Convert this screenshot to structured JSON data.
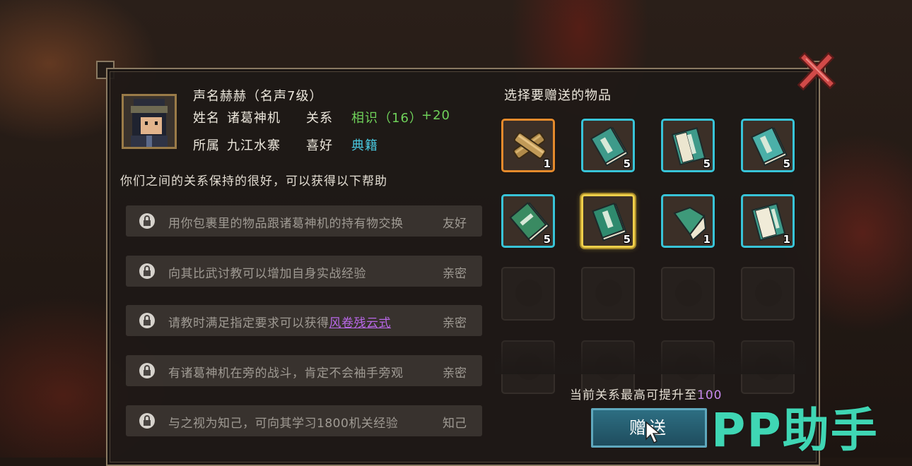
{
  "character": {
    "reputation": "声名赫赫（名声7级）",
    "name_label": "姓名",
    "name": "诸葛神机",
    "relation_label": "关系",
    "relation": "相识（16）",
    "relation_bonus": "+20",
    "faction_label": "所属",
    "faction": "九江水寨",
    "hobby_label": "喜好",
    "hobby": "典籍"
  },
  "help_intro": "你们之间的关系保持的很好，可以获得以下帮助",
  "help_items": [
    {
      "text": "用你包裹里的物品跟诸葛神机的持有物交换",
      "level": "友好"
    },
    {
      "text": "向其比武讨教可以增加自身实战经验",
      "level": "亲密"
    },
    {
      "text_prefix": "请教时满足指定要求可以获得",
      "link": "风卷残云式",
      "level": "亲密"
    },
    {
      "text": "有诸葛神机在旁的战斗，肯定不会袖手旁观",
      "level": "亲密"
    },
    {
      "text": "与之视为知己，可向其学习1800机关经验",
      "level": "知己"
    }
  ],
  "gift_panel": {
    "title": "选择要赠送的物品",
    "items": [
      {
        "icon": "bamboo-scroll-icon",
        "count": "1"
      },
      {
        "icon": "book-icon",
        "count": "5"
      },
      {
        "icon": "open-book-icon",
        "count": "5"
      },
      {
        "icon": "book-icon",
        "count": "5"
      },
      {
        "icon": "book-icon",
        "count": "5"
      },
      {
        "icon": "book-icon",
        "count": "5"
      },
      {
        "icon": "open-book-icon",
        "count": "1"
      },
      {
        "icon": "open-book-icon",
        "count": "1"
      }
    ],
    "max_label": "当前关系最高可提升至",
    "max_value": "100",
    "gift_button": "赠送"
  },
  "watermark": "PP助手",
  "colors": {
    "slot_border": "#38c4d8",
    "selected_border": "#f0d04a",
    "rare_border": "#e48a2c",
    "relation_green": "#6fd15a",
    "hobby_cyan": "#49c9e0",
    "link_purple": "#b968e8",
    "max_value_purple": "#c98bf0"
  }
}
